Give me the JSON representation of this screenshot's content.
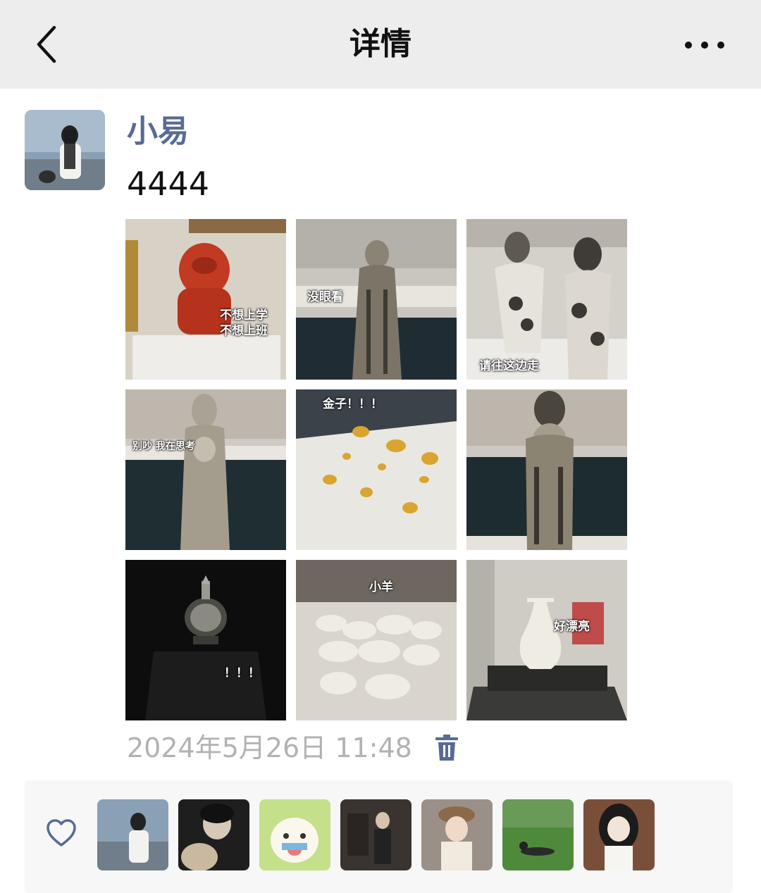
{
  "header": {
    "title": "详情",
    "back_icon": "chevron-left-icon",
    "more_icon": "more-dots-icon"
  },
  "post": {
    "author": "小易",
    "text": "4444",
    "photos": [
      {
        "caption": "不想上学\n不想上班"
      },
      {
        "caption": "没眼看"
      },
      {
        "caption": "请往这边走"
      },
      {
        "caption": "别吵 我在思考"
      },
      {
        "caption": "金子！！！"
      },
      {
        "caption": ""
      },
      {
        "caption": "！！！"
      },
      {
        "caption": "小羊"
      },
      {
        "caption": "好漂亮"
      }
    ],
    "timestamp": "2024年5月26日 11:48",
    "delete_icon": "trash-icon"
  },
  "likes": {
    "icon": "heart-outline-icon",
    "count_shown": 7
  },
  "colors": {
    "name_link": "#576b95",
    "header_bg": "#ededed",
    "time_gray": "#b2b2b2"
  }
}
